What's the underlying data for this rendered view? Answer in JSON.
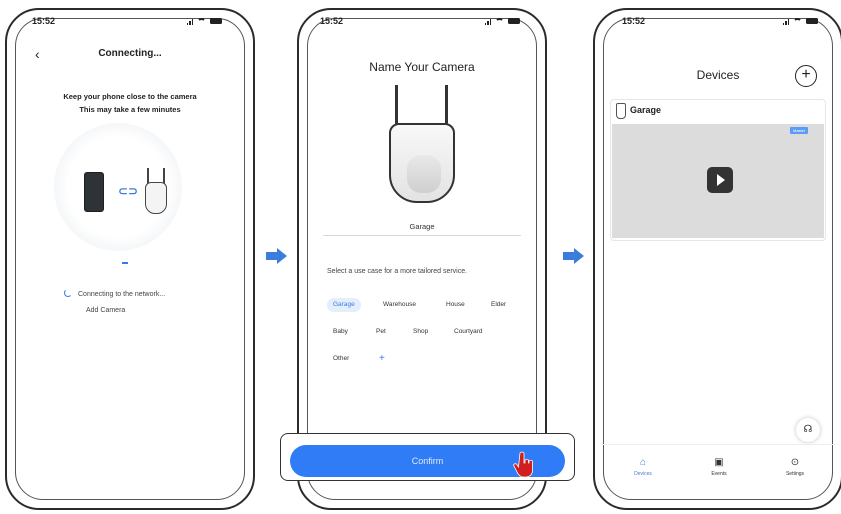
{
  "status_time": "15:52",
  "connecting_screen": {
    "title": "Connecting...",
    "message_line1": "Keep your phone close to the camera",
    "message_line2": "This may take a few minutes",
    "status_connecting": "Connecting to the network...",
    "status_add": "Add Camera"
  },
  "name_screen": {
    "title": "Name Your Camera",
    "name_value": "Garage",
    "usecase_label": "Select a use case for a more tailored service.",
    "chips": [
      "Garage",
      "Warehouse",
      "House",
      "Elder",
      "Baby",
      "Pet",
      "Shop",
      "Courtyard",
      "Other",
      "+"
    ],
    "selected_chip": "Garage",
    "confirm_label": "Confirm"
  },
  "devices_screen": {
    "title": "Devices",
    "device_name": "Garage",
    "badge": "Master",
    "tabs": [
      "Devices",
      "Events",
      "Settings"
    ],
    "active_tab": "Devices"
  },
  "colors": {
    "accent": "#2f7cf6",
    "chip_selected_bg": "#e4eefc",
    "thumb_bg": "#dcdcdc"
  }
}
